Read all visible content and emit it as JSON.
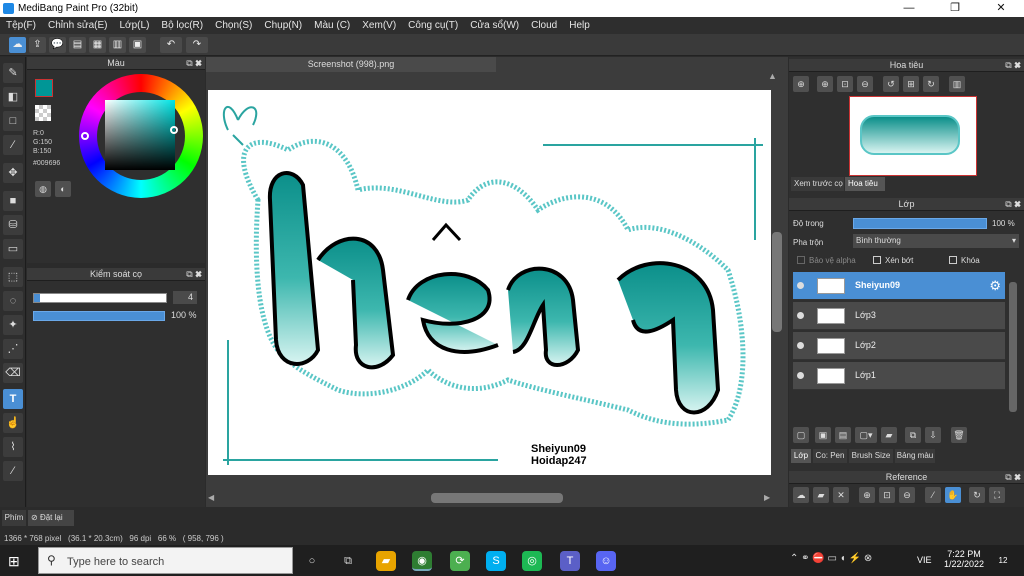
{
  "window": {
    "title": "MediBang Paint Pro (32bit)",
    "minimize": "—",
    "maximize": "❐",
    "close": "✕"
  },
  "menu": [
    "Tệp(F)",
    "Chỉnh sửa(E)",
    "Lớp(L)",
    "Bộ lọc(R)",
    "Chọn(S)",
    "Chụp(N)",
    "Màu (C)",
    "Xem(V)",
    "Công cụ(T)",
    "Cửa sổ(W)",
    "Cloud",
    "Help"
  ],
  "color_panel": {
    "title": "Màu",
    "r": "R:0",
    "g": "G:150",
    "b": "B:150",
    "hex": "#009696",
    "accent": "#009696"
  },
  "brush_panel": {
    "title": "Kiểm soát cọ",
    "size": "4",
    "opacity": "100 %",
    "opacity_fraction": 1.0
  },
  "document": {
    "tab": "Screenshot (998).png",
    "signature_line1": "Sheiyun09",
    "signature_line2": "Hoidap247"
  },
  "navigator": {
    "title": "Hoa tiêu",
    "tab_preview": "Xem trước cọ",
    "tab_nav": "Hoa tiêu"
  },
  "layers": {
    "title": "Lớp",
    "opacity_label": "Độ trong",
    "opacity_value": "100 %",
    "opacity_fraction": 1.0,
    "blend_label": "Pha trộn",
    "blend_value": "Bình thường",
    "protect_alpha": "Bảo vệ alpha",
    "clipping": "Xén bớt",
    "lock": "Khóa",
    "items": [
      {
        "name": "Sheiyun09",
        "selected": true
      },
      {
        "name": "Lớp3",
        "selected": false
      },
      {
        "name": "Lớp2",
        "selected": false
      },
      {
        "name": "Lớp1",
        "selected": false
      }
    ],
    "bottom_tabs": [
      "Lớp",
      "Co: Pen",
      "Brush Size",
      "Bảng màu"
    ]
  },
  "reference": {
    "title": "Reference"
  },
  "bottom": {
    "hint_label": "Phím",
    "reset_label": "Đặt lại",
    "status": "1366 * 768 pixel   (36.1 * 20.3cm)   96 dpi   66 %   ( 958, 796 )"
  },
  "taskbar": {
    "search_placeholder": "Type here to search",
    "time": "7:22 PM",
    "date": "1/22/2022",
    "lang": "VIE",
    "notifications": "12"
  }
}
